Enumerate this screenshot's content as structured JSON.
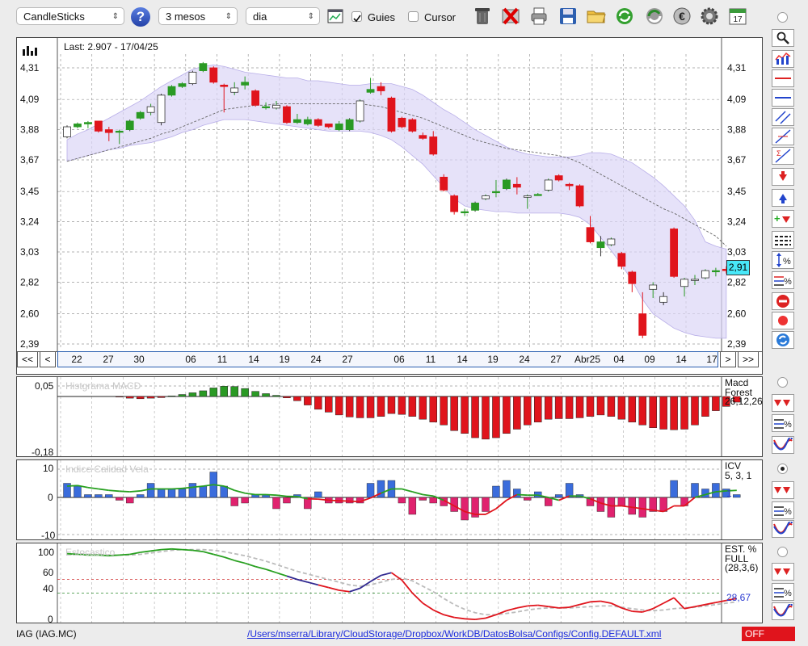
{
  "toolbar": {
    "chart_type": "CandleSticks",
    "period": "3 mesos",
    "interval": "dia",
    "guides_label": "Guies",
    "guides_checked": true,
    "cursor_label": "Cursor",
    "cursor_checked": false,
    "help_symbol": "?",
    "calendar_day": "17"
  },
  "main_chart": {
    "last_label": "Last: 2.907 - 17/04/25",
    "current_price_tag": "2,91",
    "y_ticks": [
      "4,31",
      "4,09",
      "3,88",
      "3,67",
      "3,45",
      "3,24",
      "3,03",
      "2,82",
      "2,60",
      "2,39"
    ],
    "x_ticks": [
      "22",
      "27",
      "30",
      "06",
      "11",
      "14",
      "19",
      "24",
      "27",
      "06",
      "11",
      "14",
      "19",
      "24",
      "27",
      "Abr25",
      "04",
      "09",
      "14",
      "17"
    ],
    "nav": {
      "first": "<<",
      "prev": "<",
      "next": ">",
      "last": ">>"
    }
  },
  "chart_data": [
    {
      "type": "candlestick",
      "title": "",
      "ylim": [
        2.39,
        4.31
      ],
      "y_ticks": [
        4.31,
        4.09,
        3.88,
        3.67,
        3.45,
        3.24,
        3.03,
        2.82,
        2.6,
        2.39
      ],
      "last_value": 2.907,
      "candles": [
        {
          "o": 3.83,
          "c": 3.9,
          "h": 3.91,
          "l": 3.82
        },
        {
          "o": 3.9,
          "c": 3.92,
          "h": 3.93,
          "l": 3.89
        },
        {
          "o": 3.92,
          "c": 3.93,
          "h": 3.94,
          "l": 3.89
        },
        {
          "o": 3.94,
          "c": 3.87,
          "h": 3.94,
          "l": 3.86
        },
        {
          "o": 3.88,
          "c": 3.86,
          "h": 3.9,
          "l": 3.8
        },
        {
          "o": 3.87,
          "c": 3.87,
          "h": 3.88,
          "l": 3.78
        },
        {
          "o": 3.88,
          "c": 3.94,
          "h": 3.95,
          "l": 3.87
        },
        {
          "o": 3.96,
          "c": 4.0,
          "h": 4.01,
          "l": 3.95
        },
        {
          "o": 4.0,
          "c": 4.04,
          "h": 4.06,
          "l": 3.98
        },
        {
          "o": 3.93,
          "c": 4.12,
          "h": 4.13,
          "l": 3.91
        },
        {
          "o": 4.12,
          "c": 4.18,
          "h": 4.19,
          "l": 4.11
        },
        {
          "o": 4.18,
          "c": 4.2,
          "h": 4.21,
          "l": 4.17
        },
        {
          "o": 4.2,
          "c": 4.28,
          "h": 4.29,
          "l": 4.19
        },
        {
          "o": 4.29,
          "c": 4.34,
          "h": 4.35,
          "l": 4.28
        },
        {
          "o": 4.31,
          "c": 4.21,
          "h": 4.32,
          "l": 4.2
        },
        {
          "o": 4.19,
          "c": 4.18,
          "h": 4.2,
          "l": 4.0
        },
        {
          "o": 4.14,
          "c": 4.17,
          "h": 4.21,
          "l": 4.12
        },
        {
          "o": 4.19,
          "c": 4.21,
          "h": 4.25,
          "l": 4.16
        },
        {
          "o": 4.15,
          "c": 4.05,
          "h": 4.16,
          "l": 4.04
        },
        {
          "o": 4.04,
          "c": 4.04,
          "h": 4.07,
          "l": 4.02
        },
        {
          "o": 4.03,
          "c": 4.05,
          "h": 4.08,
          "l": 4.02
        },
        {
          "o": 4.04,
          "c": 3.93,
          "h": 4.05,
          "l": 3.92
        },
        {
          "o": 3.93,
          "c": 3.95,
          "h": 3.99,
          "l": 3.92
        },
        {
          "o": 3.92,
          "c": 3.95,
          "h": 3.97,
          "l": 3.91
        },
        {
          "o": 3.95,
          "c": 3.91,
          "h": 3.96,
          "l": 3.9
        },
        {
          "o": 3.92,
          "c": 3.9,
          "h": 3.92,
          "l": 3.89
        },
        {
          "o": 3.88,
          "c": 3.92,
          "h": 3.94,
          "l": 3.87
        },
        {
          "o": 3.88,
          "c": 3.95,
          "h": 3.96,
          "l": 3.87
        },
        {
          "o": 3.94,
          "c": 4.08,
          "h": 4.09,
          "l": 3.93
        },
        {
          "o": 4.14,
          "c": 4.16,
          "h": 4.24,
          "l": 4.13
        },
        {
          "o": 4.18,
          "c": 4.15,
          "h": 4.21,
          "l": 4.12
        },
        {
          "o": 4.1,
          "c": 3.87,
          "h": 4.11,
          "l": 3.86
        },
        {
          "o": 3.96,
          "c": 3.9,
          "h": 3.97,
          "l": 3.89
        },
        {
          "o": 3.95,
          "c": 3.87,
          "h": 3.96,
          "l": 3.86
        },
        {
          "o": 3.84,
          "c": 3.82,
          "h": 3.86,
          "l": 3.81
        },
        {
          "o": 3.83,
          "c": 3.71,
          "h": 3.87,
          "l": 3.7
        },
        {
          "o": 3.55,
          "c": 3.46,
          "h": 3.57,
          "l": 3.45
        },
        {
          "o": 3.42,
          "c": 3.31,
          "h": 3.43,
          "l": 3.29
        },
        {
          "o": 3.31,
          "c": 3.31,
          "h": 3.33,
          "l": 3.28
        },
        {
          "o": 3.32,
          "c": 3.37,
          "h": 3.38,
          "l": 3.31
        },
        {
          "o": 3.4,
          "c": 3.42,
          "h": 3.43,
          "l": 3.39
        },
        {
          "o": 3.45,
          "c": 3.45,
          "h": 3.53,
          "l": 3.41
        },
        {
          "o": 3.47,
          "c": 3.53,
          "h": 3.54,
          "l": 3.46
        },
        {
          "o": 3.5,
          "c": 3.48,
          "h": 3.55,
          "l": 3.43
        },
        {
          "o": 3.41,
          "c": 3.42,
          "h": 3.43,
          "l": 3.33
        },
        {
          "o": 3.43,
          "c": 3.43,
          "h": 3.44,
          "l": 3.42
        },
        {
          "o": 3.46,
          "c": 3.53,
          "h": 3.54,
          "l": 3.45
        },
        {
          "o": 3.56,
          "c": 3.53,
          "h": 3.57,
          "l": 3.52
        },
        {
          "o": 3.5,
          "c": 3.49,
          "h": 3.51,
          "l": 3.46
        },
        {
          "o": 3.49,
          "c": 3.35,
          "h": 3.5,
          "l": 3.34
        },
        {
          "o": 3.2,
          "c": 3.1,
          "h": 3.28,
          "l": 3.09
        },
        {
          "o": 3.06,
          "c": 3.1,
          "h": 3.14,
          "l": 3.0
        },
        {
          "o": 3.08,
          "c": 3.12,
          "h": 3.13,
          "l": 3.07
        },
        {
          "o": 3.02,
          "c": 2.93,
          "h": 3.03,
          "l": 2.91
        },
        {
          "o": 2.89,
          "c": 2.81,
          "h": 2.9,
          "l": 2.75
        },
        {
          "o": 2.6,
          "c": 2.45,
          "h": 2.75,
          "l": 2.43
        },
        {
          "o": 2.77,
          "c": 2.8,
          "h": 2.82,
          "l": 2.71
        },
        {
          "o": 2.68,
          "c": 2.72,
          "h": 2.75,
          "l": 2.66
        },
        {
          "o": 3.19,
          "c": 2.86,
          "h": 3.2,
          "l": 2.85
        },
        {
          "o": 2.79,
          "c": 2.84,
          "h": 2.85,
          "l": 2.72
        },
        {
          "o": 2.84,
          "c": 2.84,
          "h": 2.87,
          "l": 2.8
        },
        {
          "o": 2.85,
          "c": 2.9,
          "h": 2.91,
          "l": 2.84
        },
        {
          "o": 2.9,
          "c": 2.9,
          "h": 2.92,
          "l": 2.86
        },
        {
          "o": 2.91,
          "c": 2.9,
          "h": 2.93,
          "l": 2.88
        }
      ],
      "ma": [
        3.66,
        3.68,
        3.7,
        3.72,
        3.74,
        3.76,
        3.78,
        3.8,
        3.82,
        3.85,
        3.87,
        3.9,
        3.93,
        3.96,
        3.99,
        4.02,
        4.03,
        4.04,
        4.05,
        4.05,
        4.06,
        4.06,
        4.06,
        4.06,
        4.06,
        4.06,
        4.06,
        4.06,
        4.06,
        4.05,
        4.04,
        4.02,
        4.0,
        3.98,
        3.96,
        3.93,
        3.9,
        3.87,
        3.84,
        3.81,
        3.79,
        3.77,
        3.75,
        3.74,
        3.73,
        3.72,
        3.71,
        3.7,
        3.68,
        3.65,
        3.61,
        3.57,
        3.53,
        3.49,
        3.45,
        3.41,
        3.37,
        3.33,
        3.3,
        3.26,
        3.22,
        3.18,
        3.14,
        3.07
      ],
      "band_upper": [
        3.81,
        3.85,
        3.88,
        3.92,
        3.96,
        4.0,
        4.04,
        4.08,
        4.13,
        4.18,
        4.22,
        4.26,
        4.3,
        4.32,
        4.33,
        4.32,
        4.3,
        4.28,
        4.27,
        4.26,
        4.25,
        4.24,
        4.24,
        4.22,
        4.22,
        4.21,
        4.2,
        4.19,
        4.19,
        4.2,
        4.2,
        4.2,
        4.18,
        4.16,
        4.12,
        4.07,
        4.02,
        3.98,
        3.93,
        3.88,
        3.84,
        3.8,
        3.76,
        3.73,
        3.71,
        3.7,
        3.69,
        3.69,
        3.69,
        3.7,
        3.72,
        3.72,
        3.71,
        3.68,
        3.65,
        3.6,
        3.55,
        3.49,
        3.42,
        3.35,
        3.25,
        3.1,
        3.07,
        3.05
      ],
      "band_lower": [
        3.66,
        3.68,
        3.7,
        3.72,
        3.74,
        3.75,
        3.77,
        3.78,
        3.79,
        3.81,
        3.83,
        3.86,
        3.88,
        3.91,
        3.93,
        3.95,
        3.95,
        3.95,
        3.94,
        3.93,
        3.92,
        3.91,
        3.9,
        3.89,
        3.88,
        3.87,
        3.87,
        3.87,
        3.87,
        3.86,
        3.84,
        3.81,
        3.76,
        3.7,
        3.64,
        3.56,
        3.48,
        3.4,
        3.35,
        3.33,
        3.32,
        3.31,
        3.31,
        3.3,
        3.3,
        3.3,
        3.3,
        3.3,
        3.29,
        3.27,
        3.22,
        3.13,
        3.04,
        2.94,
        2.83,
        2.7,
        2.6,
        2.55,
        2.5,
        2.47,
        2.45,
        2.44,
        2.43,
        2.43
      ]
    },
    {
      "type": "bar",
      "title": "Histgrama MACD",
      "indicator_label": "Macd Forest",
      "params": "26,12,26",
      "ylim": [
        -0.18,
        0.05
      ],
      "y_ticks": [
        "0,05",
        "-0,18"
      ],
      "values": [
        0,
        0,
        0,
        0,
        0,
        -0.002,
        -0.006,
        -0.008,
        -0.006,
        -0.004,
        0.002,
        0.007,
        0.013,
        0.02,
        0.03,
        0.036,
        0.035,
        0.028,
        0.018,
        0.01,
        0.004,
        -0.005,
        -0.015,
        -0.03,
        -0.045,
        -0.055,
        -0.065,
        -0.072,
        -0.075,
        -0.075,
        -0.07,
        -0.06,
        -0.063,
        -0.07,
        -0.08,
        -0.09,
        -0.1,
        -0.12,
        -0.13,
        -0.145,
        -0.15,
        -0.145,
        -0.13,
        -0.115,
        -0.1,
        -0.09,
        -0.08,
        -0.078,
        -0.078,
        -0.075,
        -0.07,
        -0.065,
        -0.07,
        -0.08,
        -0.09,
        -0.1,
        -0.11,
        -0.115,
        -0.117,
        -0.115,
        -0.1,
        -0.07,
        -0.05,
        -0.035,
        -0.02
      ]
    },
    {
      "type": "bar",
      "title": "Indice Calidad Vela",
      "indicator_label": "ICV",
      "params": "5, 3, 1",
      "signal_value": "1",
      "ylim": [
        -10,
        10
      ],
      "y_ticks": [
        "10",
        "0",
        "-10"
      ],
      "values": [
        5,
        4,
        1,
        1,
        1,
        -1,
        -2,
        1,
        5,
        3,
        3,
        3,
        5,
        4,
        9,
        4,
        -3,
        -2,
        1,
        1,
        -4,
        -2,
        1,
        -4,
        2,
        -2,
        -2,
        -2,
        -2,
        5,
        6,
        6,
        -2,
        -6,
        -1,
        -2,
        -3,
        -5,
        -8,
        -7,
        -5,
        4,
        6,
        3,
        -1,
        2,
        -3,
        1,
        5,
        1,
        -3,
        -5,
        -7,
        -3,
        -6,
        -7,
        -5,
        -5,
        6,
        -3,
        5,
        3,
        5,
        3,
        1
      ],
      "signal": [
        4,
        4.2,
        3.5,
        3,
        2.5,
        2.2,
        2,
        2.3,
        3,
        3,
        3,
        3.2,
        3.6,
        4,
        4.5,
        4,
        2.5,
        1.5,
        1,
        1,
        0.8,
        0.4,
        0.3,
        -0.5,
        -0.6,
        -1,
        -1.2,
        -1.3,
        -1.5,
        -0.2,
        1.5,
        3,
        3,
        2,
        1,
        0.5,
        -1,
        -3,
        -5,
        -6,
        -6,
        -4,
        -1,
        1,
        0.8,
        0.8,
        0,
        -1,
        0.5,
        0.5,
        -0.5,
        -2,
        -3,
        -3,
        -3.5,
        -4,
        -4.5,
        -5,
        -3,
        -3,
        0,
        1,
        2,
        2.3,
        2.5
      ]
    },
    {
      "type": "line",
      "title": "Estocastico",
      "indicator_label": "EST. % FULL",
      "params": "(28,3,6)",
      "value_label": "28,67",
      "ylim": [
        0,
        100
      ],
      "y_ticks": [
        "100",
        "60",
        "40",
        "0"
      ],
      "k": [
        98,
        97,
        96,
        96,
        95,
        96,
        97,
        100,
        102,
        104,
        105,
        104,
        103,
        101,
        97,
        93,
        88,
        84,
        79,
        75,
        70,
        65,
        60,
        56,
        52,
        48,
        44,
        42,
        47,
        57,
        66,
        70,
        59,
        40,
        25,
        15,
        8,
        4,
        2,
        1,
        3,
        8,
        14,
        18,
        21,
        22,
        20,
        18,
        19,
        23,
        27,
        28,
        25,
        18,
        13,
        12,
        17,
        25,
        33,
        17,
        20,
        23,
        26,
        29,
        32
      ],
      "d": [
        98,
        98,
        97,
        97,
        96,
        96,
        96,
        97,
        99,
        101,
        103,
        104,
        104,
        104,
        103,
        101,
        98,
        95,
        91,
        87,
        82,
        77,
        72,
        68,
        64,
        60,
        56,
        52,
        50,
        52,
        56,
        60,
        62,
        58,
        50,
        42,
        32,
        23,
        16,
        11,
        8,
        8,
        10,
        12,
        15,
        17,
        18,
        18,
        18,
        19,
        20,
        21,
        21,
        19,
        17,
        15,
        14,
        15,
        17,
        18,
        19,
        21,
        23,
        25,
        27
      ]
    }
  ],
  "macd_panel": {
    "title": "Histgrama MACD",
    "label1": "Macd",
    "label2": "Forest",
    "params": "26,12,26",
    "y_top": "0,05",
    "y_bottom": "-0,18"
  },
  "icv_panel": {
    "title": "Indice Calidad Vela",
    "label": "ICV",
    "params": "5, 3, 1",
    "y_top": "10",
    "y_mid": "0",
    "y_bottom": "-10",
    "value": "1"
  },
  "stoch_panel": {
    "title": "Estocastico",
    "label1": "EST. %",
    "label2": "FULL",
    "params": "(28,3,6)",
    "value": "28,67",
    "y_100": "100",
    "y_60": "60",
    "y_40": "40",
    "y_0": "0"
  },
  "statusbar": {
    "symbol": "IAG (IAG.MC)",
    "config_path": "/Users/mserra/Library/CloudStorage/Dropbox/WorkDB/DatosBolsa/Configs/Config.DEFAULT.xml",
    "off_badge": "OFF"
  },
  "colors": {
    "bull": "#2a9a24",
    "bear": "#e0141c",
    "band": "#dcd6f6",
    "icv_up": "#3a6cdc",
    "icv_down": "#e0226e",
    "stoch_green": "#28a020",
    "stoch_blue": "#302890",
    "stoch_red": "#e0141c",
    "price_tag": "#48e8f8"
  }
}
